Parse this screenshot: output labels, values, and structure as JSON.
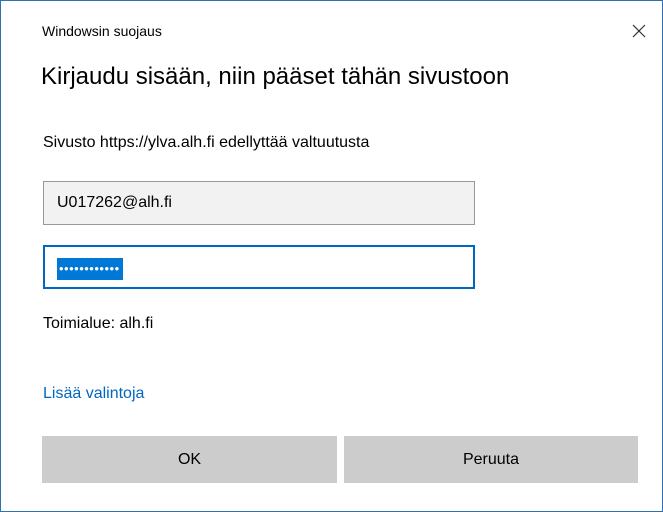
{
  "dialog": {
    "window_title": "Windowsin suojaus",
    "heading": "Kirjaudu sisään, niin pääset tähän sivustoon",
    "site_message": "Sivusto https://ylva.alh.fi edellyttää valtuutusta",
    "username_value": "U017262@alh.fi",
    "password_mask": "••••••••••••",
    "domain_text": "Toimialue: alh.fi",
    "more_options_label": "Lisää valintoja",
    "ok_label": "OK",
    "cancel_label": "Peruuta",
    "close_icon": "close-icon"
  },
  "colors": {
    "accent": "#0067c0",
    "selection": "#0078d7",
    "button_bg": "#cccccc",
    "window_border": "#2f6fb3"
  }
}
